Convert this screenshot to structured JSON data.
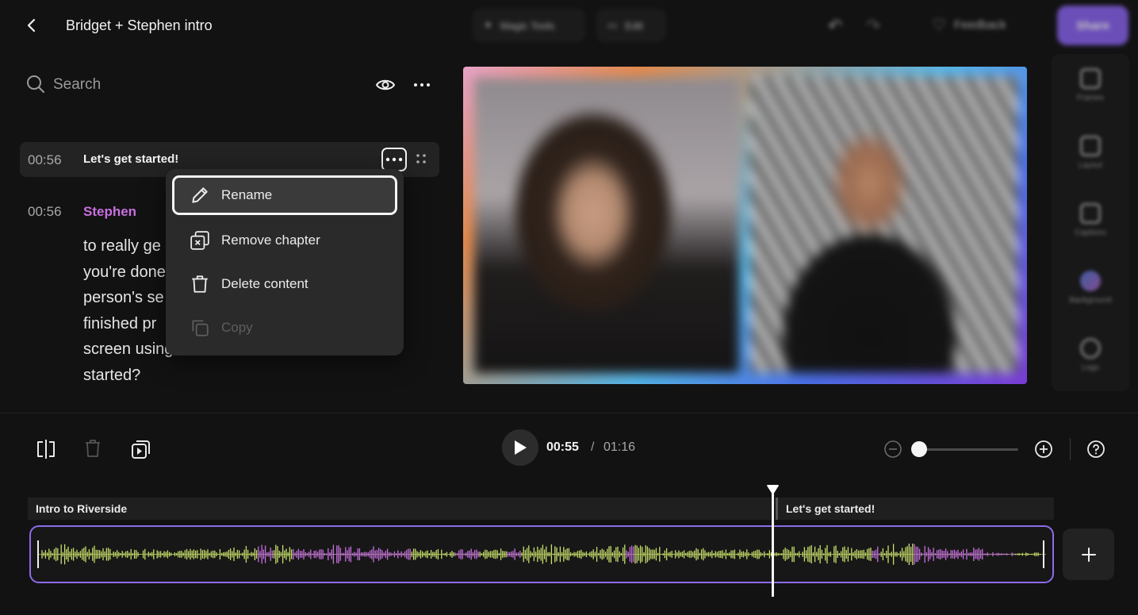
{
  "header": {
    "title": "Bridget + Stephen intro",
    "magic_tools_label": "Magic Tools",
    "edit_label": "Edit",
    "feedback_label": "Feedback",
    "share_label": "Share"
  },
  "search": {
    "placeholder": "Search"
  },
  "chapter": {
    "time": "00:56",
    "title": "Let's get started!"
  },
  "speaker_block": {
    "time": "00:56",
    "speaker": "Stephen",
    "lines": [
      "to really ge",
      "you're done",
      "person's se",
      "finished pr",
      "screen using",
      "started?"
    ]
  },
  "context_menu": {
    "items": [
      {
        "label": "Rename",
        "icon": "pencil-icon"
      },
      {
        "label": "Remove chapter",
        "icon": "remove-chapter-icon"
      },
      {
        "label": "Delete content",
        "icon": "trash-icon"
      },
      {
        "label": "Copy",
        "icon": "copy-icon"
      }
    ]
  },
  "side_tools": [
    "Frames",
    "Layout",
    "Captions",
    "Background",
    "Logo"
  ],
  "playback": {
    "current": "00:55",
    "separator": "/",
    "total": "01:16"
  },
  "timeline": {
    "chapters": [
      {
        "label": "Intro to Riverside"
      },
      {
        "label": "Let's get started!"
      }
    ],
    "progress": 0.72
  },
  "colors": {
    "accent": "#8e6be9",
    "speaker_a_wave": "#c8e06a",
    "speaker_b_wave": "#c86fe0",
    "speaker_name": "#c86fe0"
  }
}
